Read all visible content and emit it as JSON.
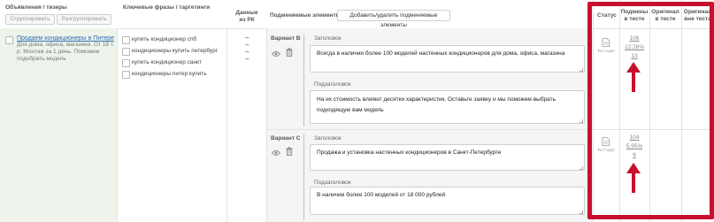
{
  "headers": {
    "ads": "Объявления / тизеры",
    "phrases": "Ключевые фразы / таргетинги",
    "rk_line1": "Данные",
    "rk_line2": "из РК",
    "variants": "Подменяемые элементы",
    "status": "Статус",
    "replaced_line1": "Подмены",
    "replaced_line2": "в тесте",
    "original_test_line1": "Оригинал",
    "original_test_line2": "в тесте",
    "original_out_line1": "Оригинал",
    "original_out_line2": "вне теста"
  },
  "toolbar": {
    "group_label": "Сгруппировать",
    "ungroup_label": "Разгруппировать",
    "add_remove_label": "Добавить/удалить подменяемые элементы"
  },
  "ad": {
    "title": "Продаем кондиционеры в Питере",
    "text_line1": "Для дома, офиса, магазина. От 18 т.",
    "text_line2": "р. Монтаж за 1 день. Поможем",
    "text_line3": "подобрать модель"
  },
  "phrases": [
    "купить кондиционер спб",
    "кондиционеры купить петербург",
    "купить кондиционер санкт",
    "кондиционеры питер купить"
  ],
  "rk": {
    "dash1": "–",
    "dash2": "–",
    "dash3": "–",
    "dash4": "–"
  },
  "variants": [
    {
      "label": "Вариант B",
      "heading_label": "Заголовок",
      "heading_value": "Всегда в наличии более 100 моделей настенных кондиционеров для дома, офиса, магазина",
      "sub_label": "Подзаголовок",
      "sub_value_line1": "На их стоимость влияют десятки характеристик. Оставьте заявку и мы поможем выбрать",
      "sub_value_line2": "подходящую вам модель",
      "status_text": "Тест идет",
      "stat1": "106",
      "stat2": "12.26%",
      "stat3": "13"
    },
    {
      "label": "Вариант C",
      "heading_label": "Заголовок",
      "heading_value": "Продажа и установка настенных кондиционеров в Санкт-Петербурге",
      "sub_label": "Подзаголовок",
      "sub_value_line1": "В наличии более 100 моделей от 18 000 рублей",
      "sub_value_line2": "",
      "status_text": "Тест идет",
      "stat1": "104",
      "stat2": "5.95%",
      "stat3": "6"
    }
  ],
  "colors": {
    "highlight": "#c8102e",
    "link": "#2f6fb5",
    "ad_bg": "#eef4ec"
  },
  "icons": [
    "eye-icon",
    "trash-icon",
    "doc-icon",
    "arrow-up-icon"
  ]
}
